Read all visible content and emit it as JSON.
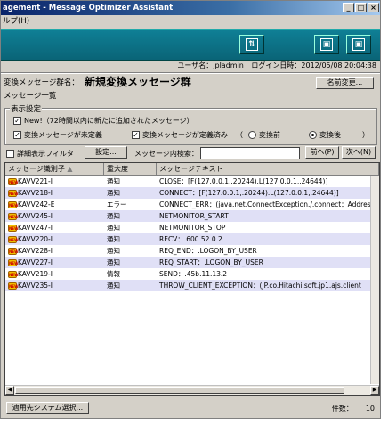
{
  "window": {
    "title": "agement - Message Optimizer Assistant"
  },
  "menu": {
    "help": "ルプ(H)"
  },
  "userbar": {
    "user_label": "ユーザ名：",
    "user": "jpladmin",
    "login_label": "ログイン日時：",
    "login": "2012/05/08 20:04:38"
  },
  "group": {
    "label": "変換メッセージ群名：",
    "name": "新規変換メッセージ群",
    "rename_button": "名前変更..."
  },
  "message_list_label": "メッセージ一覧",
  "display_settings": {
    "legend": "表示設定",
    "new_checkbox": "New!（72時間以内に新たに追加されたメッセージ）",
    "undefined_checkbox": "変換メッセージが未定義",
    "defined_checkbox": "変換メッセージが定義済み",
    "radio_before": "変換前",
    "radio_after": "変換後",
    "paren_open": "（",
    "paren_close": "）"
  },
  "filter": {
    "detail_checkbox": "詳細表示フィルタ",
    "settings_button": "設定...",
    "search_label": "メッセージ内検索：",
    "search_value": "",
    "prev_button": "前へ(P)",
    "next_button": "次へ(N)"
  },
  "table": {
    "columns": [
      "メッセージ識別子",
      "重大度",
      "メッセージテキスト"
    ],
    "rows": [
      {
        "id": "KAVV221-I",
        "severity": "通知",
        "text": "CLOSE：[F(127.0.0.1,.20244).L(127.0.0.1,.24644)]"
      },
      {
        "id": "KAVV218-I",
        "severity": "通知",
        "text": "CONNECT：[F(127.0.0.1,.20244).L(127.0.0.1,.24644)]"
      },
      {
        "id": "KAVV242-E",
        "severity": "エラー",
        "text": "CONNECT_ERR：(java.net.ConnectException./.connect：Address"
      },
      {
        "id": "KAVV245-I",
        "severity": "通知",
        "text": "NETMONITOR_START"
      },
      {
        "id": "KAVV247-I",
        "severity": "通知",
        "text": "NETMONITOR_STOP"
      },
      {
        "id": "KAVV220-I",
        "severity": "通知",
        "text": "RECV：.600.52.0.2"
      },
      {
        "id": "KAVV228-I",
        "severity": "通知",
        "text": "REQ_END：.LOGON_BY_USER"
      },
      {
        "id": "KAVV227-I",
        "severity": "通知",
        "text": "REQ_START：.LOGON_BY_USER"
      },
      {
        "id": "KAVV219-I",
        "severity": "情報",
        "text": "SEND：.45b.11.13.2"
      },
      {
        "id": "KAVV235-I",
        "severity": "通知",
        "text": "THROW_CLIENT_EXCEPTION：(JP.co.Hitachi.soft.jp1.ajs.client"
      }
    ]
  },
  "footer": {
    "system_button": "適用先システム選択...",
    "count_label": "件数：",
    "count": "10"
  },
  "icons": {
    "new_badge": "NEW"
  }
}
